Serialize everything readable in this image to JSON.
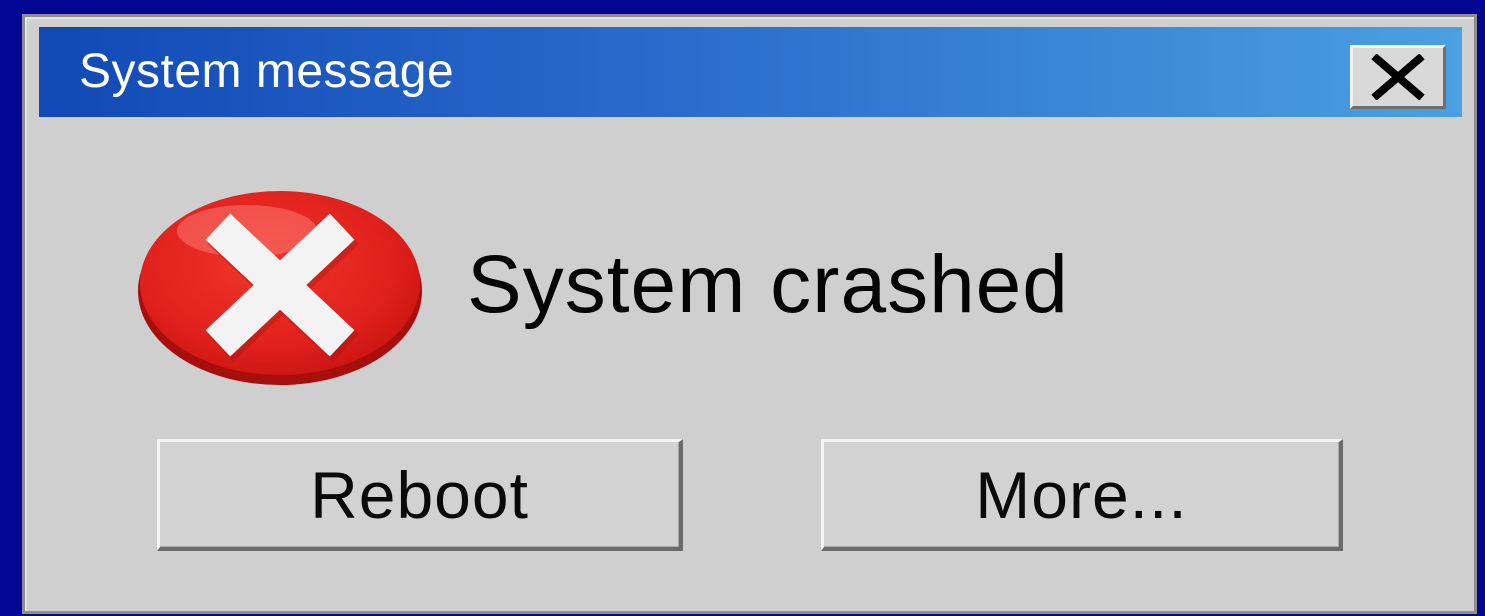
{
  "window": {
    "title": "System message",
    "close_icon": "close-icon"
  },
  "message": {
    "icon": "error-icon",
    "text": "System crashed"
  },
  "buttons": {
    "reboot_label": "Reboot",
    "more_label": "More..."
  },
  "colors": {
    "background": "#040694",
    "titlebar_start": "#1149b6",
    "titlebar_end": "#4aa0e0",
    "dialog": "#cfcfcf",
    "error_red": "#e0201c"
  }
}
